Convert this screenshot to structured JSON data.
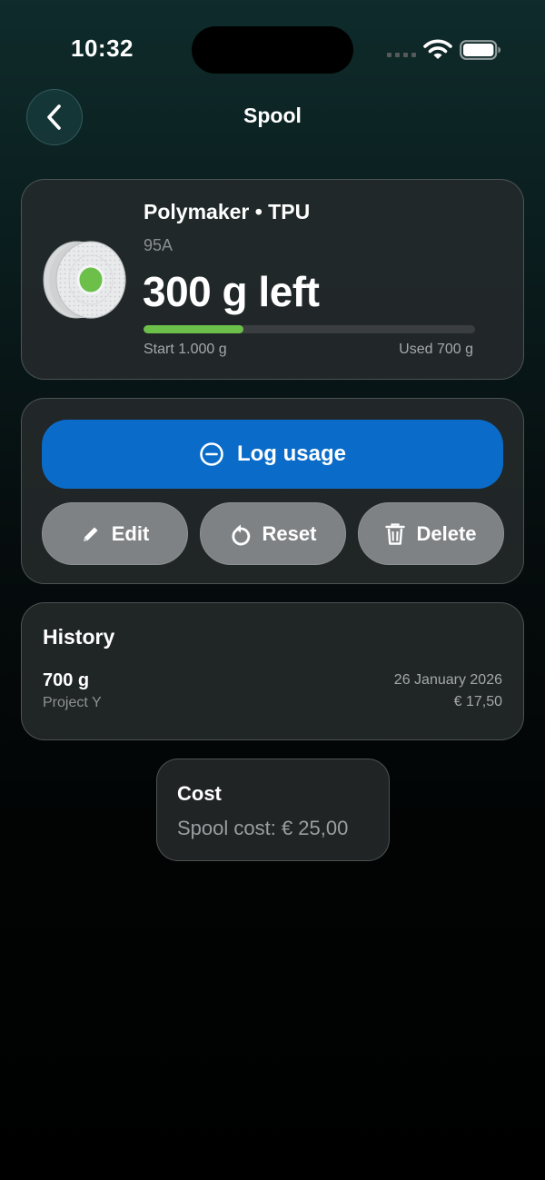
{
  "status_bar": {
    "time": "10:32",
    "icons": [
      "cellular-signal-icon",
      "wifi-icon",
      "battery-icon"
    ]
  },
  "nav": {
    "title": "Spool",
    "back_icon": "chevron-left-icon"
  },
  "spool": {
    "title": "Polymaker • TPU",
    "subtitle": "95A",
    "remaining": "300 g left",
    "start": "Start 1.000 g",
    "used": "Used 700 g",
    "remaining_fraction": 0.3,
    "icon": "filament-spool-icon",
    "spool_color": "#6cc04a",
    "progress_color": "#6cc04a"
  },
  "actions": {
    "log_usage": {
      "label": "Log usage",
      "icon": "minus-circle-icon"
    },
    "edit": {
      "label": "Edit",
      "icon": "pencil-icon"
    },
    "reset": {
      "label": "Reset",
      "icon": "reset-arrow-icon"
    },
    "delete": {
      "label": "Delete",
      "icon": "trash-icon"
    },
    "primary_color": "#0a6cc8"
  },
  "history": {
    "title": "History",
    "entries": [
      {
        "amount": "700 g",
        "project": "Project Y",
        "date": "26 January 2026",
        "cost": "€ 17,50"
      }
    ]
  },
  "cost": {
    "title": "Cost",
    "value": "Spool cost: € 25,00"
  }
}
